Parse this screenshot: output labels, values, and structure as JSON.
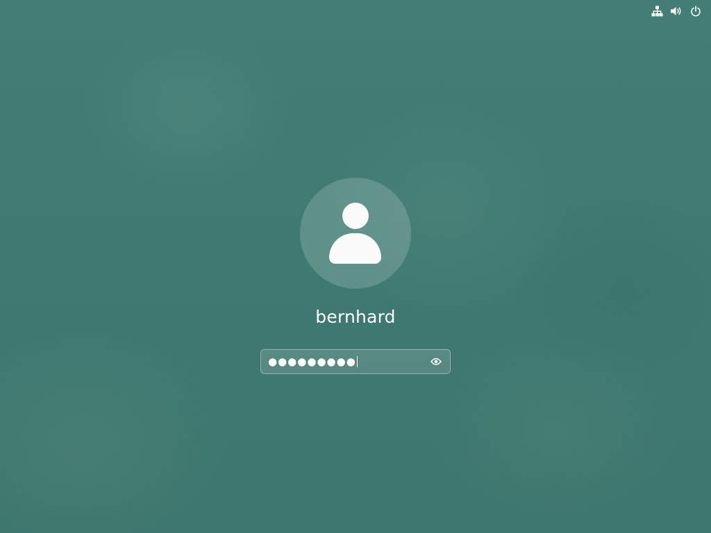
{
  "tray": {
    "network_icon": "network-wired-icon",
    "volume_icon": "speaker-volume-icon",
    "power_icon": "power-icon"
  },
  "user": {
    "avatar_icon": "user-avatar-icon",
    "name": "bernhard"
  },
  "password": {
    "masked_value": "●●●●●●●●●",
    "reveal_icon": "eye-icon"
  },
  "colors": {
    "background": "#417b73",
    "foreground": "#ffffff"
  }
}
